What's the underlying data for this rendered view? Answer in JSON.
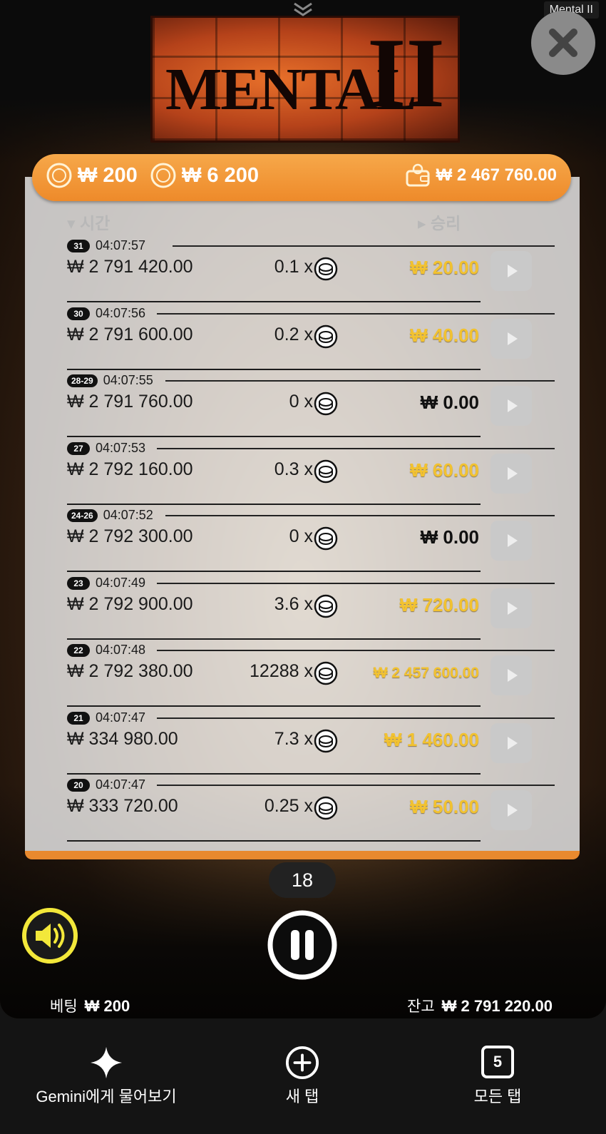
{
  "window": {
    "title": "Mental II"
  },
  "logo": {
    "text": "MENTAL",
    "numeral": "II"
  },
  "header": {
    "bet": "₩ 200",
    "total": "₩ 6 200",
    "balance": "₩ 2 467 760.00"
  },
  "columns": {
    "time": "시간",
    "win": "승리"
  },
  "history": [
    {
      "round": "31",
      "time": "04:07:57",
      "balance": "₩ 2 791 420.00",
      "multiplier": "0.1 x",
      "win": "₩ 20.00",
      "zero": false
    },
    {
      "round": "30",
      "time": "04:07:56",
      "balance": "₩ 2 791 600.00",
      "multiplier": "0.2 x",
      "win": "₩ 40.00",
      "zero": false
    },
    {
      "round": "28-29",
      "time": "04:07:55",
      "balance": "₩ 2 791 760.00",
      "multiplier": "0 x",
      "win": "₩ 0.00",
      "zero": true
    },
    {
      "round": "27",
      "time": "04:07:53",
      "balance": "₩ 2 792 160.00",
      "multiplier": "0.3 x",
      "win": "₩ 60.00",
      "zero": false
    },
    {
      "round": "24-26",
      "time": "04:07:52",
      "balance": "₩ 2 792 300.00",
      "multiplier": "0 x",
      "win": "₩ 0.00",
      "zero": true
    },
    {
      "round": "23",
      "time": "04:07:49",
      "balance": "₩ 2 792 900.00",
      "multiplier": "3.6 x",
      "win": "₩ 720.00",
      "zero": false
    },
    {
      "round": "22",
      "time": "04:07:48",
      "balance": "₩ 2 792 380.00",
      "multiplier": "12288 x",
      "win": "₩ 2 457 600.00",
      "zero": false
    },
    {
      "round": "21",
      "time": "04:07:47",
      "balance": "₩ 334 980.00",
      "multiplier": "7.3 x",
      "win": "₩ 1 460.00",
      "zero": false
    },
    {
      "round": "20",
      "time": "04:07:47",
      "balance": "₩ 333 720.00",
      "multiplier": "0.25 x",
      "win": "₩ 50.00",
      "zero": false
    }
  ],
  "spin_counter": "18",
  "footer": {
    "bet_label": "베팅",
    "bet_value": "₩ 200",
    "balance_label": "잔고",
    "balance_value": "₩ 2 791 220.00"
  },
  "browser_nav": {
    "gemini": "Gemini에게 물어보기",
    "new_tab": "새 탭",
    "all_tabs": "모든 탭",
    "tab_count": "5"
  },
  "colors": {
    "accent": "#ee8a2a",
    "win": "#f2c230",
    "sound_ring": "#f3e83a"
  },
  "icons": [
    "chevron-down-icon",
    "close-icon",
    "coin-icon",
    "wallet-icon",
    "sort-down-icon",
    "sort-right-icon",
    "play-icon",
    "speaker-icon",
    "pause-icon",
    "sparkle-icon",
    "plus-circle-icon",
    "tabs-icon"
  ]
}
